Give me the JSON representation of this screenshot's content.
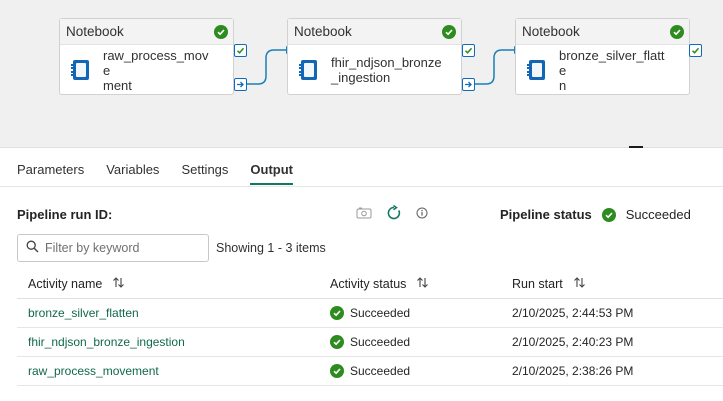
{
  "pipeline": {
    "activities": [
      {
        "type": "Notebook",
        "name": "raw_process_movement",
        "name_line1": "raw_process_move",
        "name_line2": "ment",
        "icon": "notebook-icon",
        "status_icon": "success-check-icon"
      },
      {
        "type": "Notebook",
        "name": "fhir_ndjson_bronze_ingestion",
        "name_line1": "fhir_ndjson_bronze",
        "name_line2": "_ingestion",
        "icon": "notebook-icon",
        "status_icon": "success-check-icon"
      },
      {
        "type": "Notebook",
        "name": "bronze_silver_flatten",
        "name_line1": "bronze_silver_flatte",
        "name_line2": "n",
        "icon": "notebook-icon",
        "status_icon": "success-check-icon"
      }
    ]
  },
  "tabs": [
    "Parameters",
    "Variables",
    "Settings",
    "Output"
  ],
  "active_tab": "Output",
  "output": {
    "run_id_label": "Pipeline run ID:",
    "pipeline_status_label": "Pipeline status",
    "pipeline_status_value": "Succeeded",
    "filter_placeholder": "Filter by keyword",
    "items_count": "Showing 1 - 3 items",
    "columns": [
      "Activity name",
      "Activity status",
      "Run start"
    ],
    "rows": [
      {
        "activity_name": "bronze_silver_flatten",
        "status": "Succeeded",
        "run_start": "2/10/2025, 2:44:53 PM"
      },
      {
        "activity_name": "fhir_ndjson_bronze_ingestion",
        "status": "Succeeded",
        "run_start": "2/10/2025, 2:40:23 PM"
      },
      {
        "activity_name": "raw_process_movement",
        "status": "Succeeded",
        "run_start": "2/10/2025, 2:38:26 PM"
      }
    ]
  },
  "colors": {
    "success": "#2e8b1f",
    "accent": "#117865",
    "link": "#116949",
    "port": "#0f6cbd",
    "notebook": "#1266b5"
  }
}
